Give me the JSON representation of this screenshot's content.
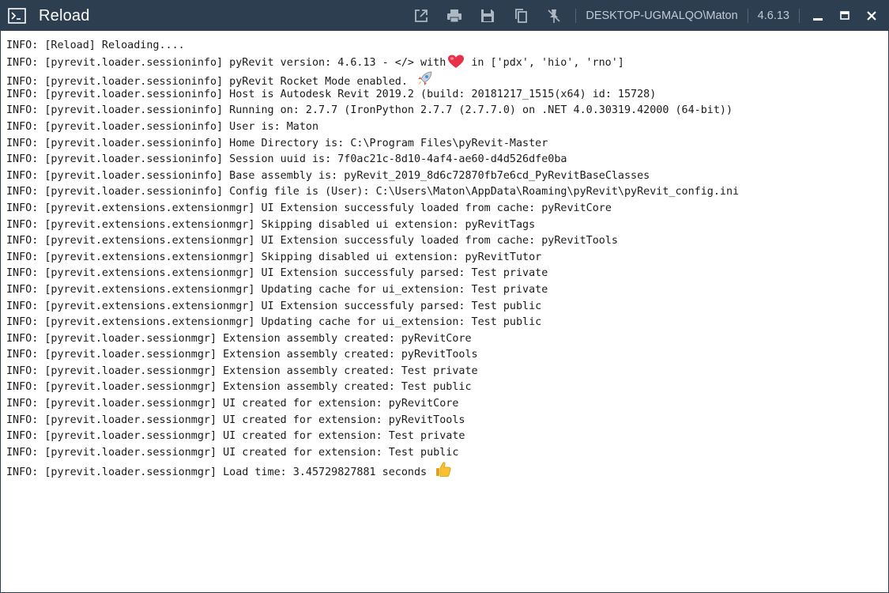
{
  "window": {
    "title": "Reload",
    "host_user": "DESKTOP-UGMALQO\\Maton",
    "version": "4.6.13",
    "icons": {
      "app": "terminal-icon",
      "open_external": "open-external-icon",
      "print": "print-icon",
      "save": "save-icon",
      "copy": "copy-icon",
      "pin": "pin-off-icon",
      "minimize": "minimize-icon",
      "maximize": "maximize-icon",
      "close": "close-icon"
    },
    "colors": {
      "titlebar": "#2c3e50",
      "text": "#1a1a1a"
    }
  },
  "log": {
    "lines": [
      "INFO: [Reload] Reloading....",
      "INFO: [pyrevit.loader.sessioninfo] pyRevit version: 4.6.13 - </> with",
      "INFO: [pyrevit.loader.sessioninfo] pyRevit Rocket Mode enabled.",
      "INFO: [pyrevit.loader.sessioninfo] Host is Autodesk Revit 2019.2 (build: 20181217_1515(x64) id: 15728)",
      "INFO: [pyrevit.loader.sessioninfo] Running on: 2.7.7 (IronPython 2.7.7 (2.7.7.0) on .NET 4.0.30319.42000 (64-bit))",
      "INFO: [pyrevit.loader.sessioninfo] User is: Maton",
      "INFO: [pyrevit.loader.sessioninfo] Home Directory is: C:\\Program Files\\pyRevit-Master",
      "INFO: [pyrevit.loader.sessioninfo] Session uuid is: 7f0ac21c-8d10-4af4-ae60-d4d526dfe0ba",
      "INFO: [pyrevit.loader.sessioninfo] Base assembly is: pyRevit_2019_8d6c72870fb7e6cd_PyRevitBaseClasses",
      "INFO: [pyrevit.loader.sessioninfo] Config file is (User): C:\\Users\\Maton\\AppData\\Roaming\\pyRevit\\pyRevit_config.ini",
      "INFO: [pyrevit.extensions.extensionmgr] UI Extension successfuly loaded from cache: pyRevitCore",
      "INFO: [pyrevit.extensions.extensionmgr] Skipping disabled ui extension: pyRevitTags",
      "INFO: [pyrevit.extensions.extensionmgr] UI Extension successfuly loaded from cache: pyRevitTools",
      "INFO: [pyrevit.extensions.extensionmgr] Skipping disabled ui extension: pyRevitTutor",
      "INFO: [pyrevit.extensions.extensionmgr] UI Extension successfuly parsed: Test private",
      "INFO: [pyrevit.extensions.extensionmgr] Updating cache for ui_extension: Test private",
      "INFO: [pyrevit.extensions.extensionmgr] UI Extension successfuly parsed: Test public",
      "INFO: [pyrevit.extensions.extensionmgr] Updating cache for ui_extension: Test public",
      "INFO: [pyrevit.loader.sessionmgr] Extension assembly created: pyRevitCore",
      "INFO: [pyrevit.loader.sessionmgr] Extension assembly created: pyRevitTools",
      "INFO: [pyrevit.loader.sessionmgr] Extension assembly created: Test private",
      "INFO: [pyrevit.loader.sessionmgr] Extension assembly created: Test public",
      "INFO: [pyrevit.loader.sessionmgr] UI created for extension: pyRevitCore",
      "INFO: [pyrevit.loader.sessionmgr] UI created for extension: pyRevitTools",
      "INFO: [pyrevit.loader.sessionmgr] UI created for extension: Test private",
      "INFO: [pyrevit.loader.sessionmgr] UI created for extension: Test public",
      "INFO: [pyrevit.loader.sessionmgr] Load time: 3.45729827881 seconds"
    ],
    "version_suffix": "in ['pdx', 'hio', 'rno']",
    "emoji_icons": {
      "heart": "heart-icon",
      "rocket": "rocket-icon",
      "thumbs_up": "thumbs-up-icon"
    }
  }
}
